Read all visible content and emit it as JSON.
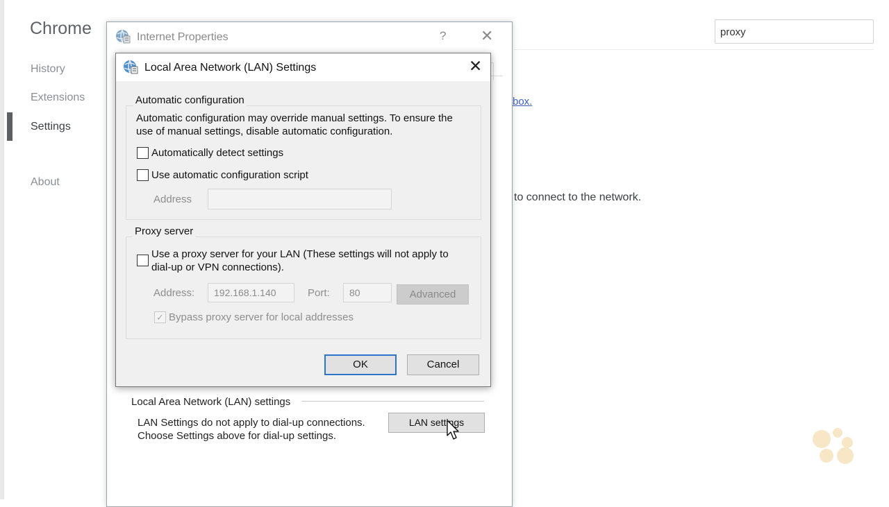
{
  "chrome": {
    "title": "Chrome",
    "nav": [
      "History",
      "Extensions",
      "Settings",
      "About"
    ],
    "search_value": "proxy",
    "link_fragment": "box.",
    "text_fragment": "to connect to the network."
  },
  "internet_properties": {
    "title": "Internet Properties",
    "help": "?",
    "close": "✕",
    "lan_section_title": "Local Area Network (LAN) settings",
    "lan_desc_line1": "LAN Settings do not apply to dial-up connections.",
    "lan_desc_line2": "Choose Settings above for dial-up settings.",
    "lan_button": "LAN settings"
  },
  "lan_dialog": {
    "title": "Local Area Network (LAN) Settings",
    "close": "✕",
    "auto_config": {
      "group_label": "Automatic configuration",
      "desc_line1": "Automatic configuration may override manual settings.  To ensure the",
      "desc_line2": "use of manual settings, disable automatic configuration.",
      "auto_detect_label": "Automatically detect settings",
      "auto_detect_checked": false,
      "script_label": "Use automatic configuration script",
      "script_checked": false,
      "address_label": "Address",
      "address_value": ""
    },
    "proxy": {
      "group_label": "Proxy server",
      "use_proxy_line1": "Use a proxy server for your LAN (These settings will not apply to",
      "use_proxy_line2": "dial-up or VPN connections).",
      "use_proxy_checked": false,
      "address_label": "Address:",
      "address_value": "192.168.1.140",
      "port_label": "Port:",
      "port_value": "80",
      "advanced_label": "Advanced",
      "bypass_label": "Bypass proxy server for local addresses",
      "bypass_checked": true
    },
    "ok_label": "OK",
    "cancel_label": "Cancel"
  },
  "colors": {
    "accent_focus": "#2c74c9",
    "link": "#3b5fc0",
    "dialog_bg": "#f0f0f0"
  }
}
